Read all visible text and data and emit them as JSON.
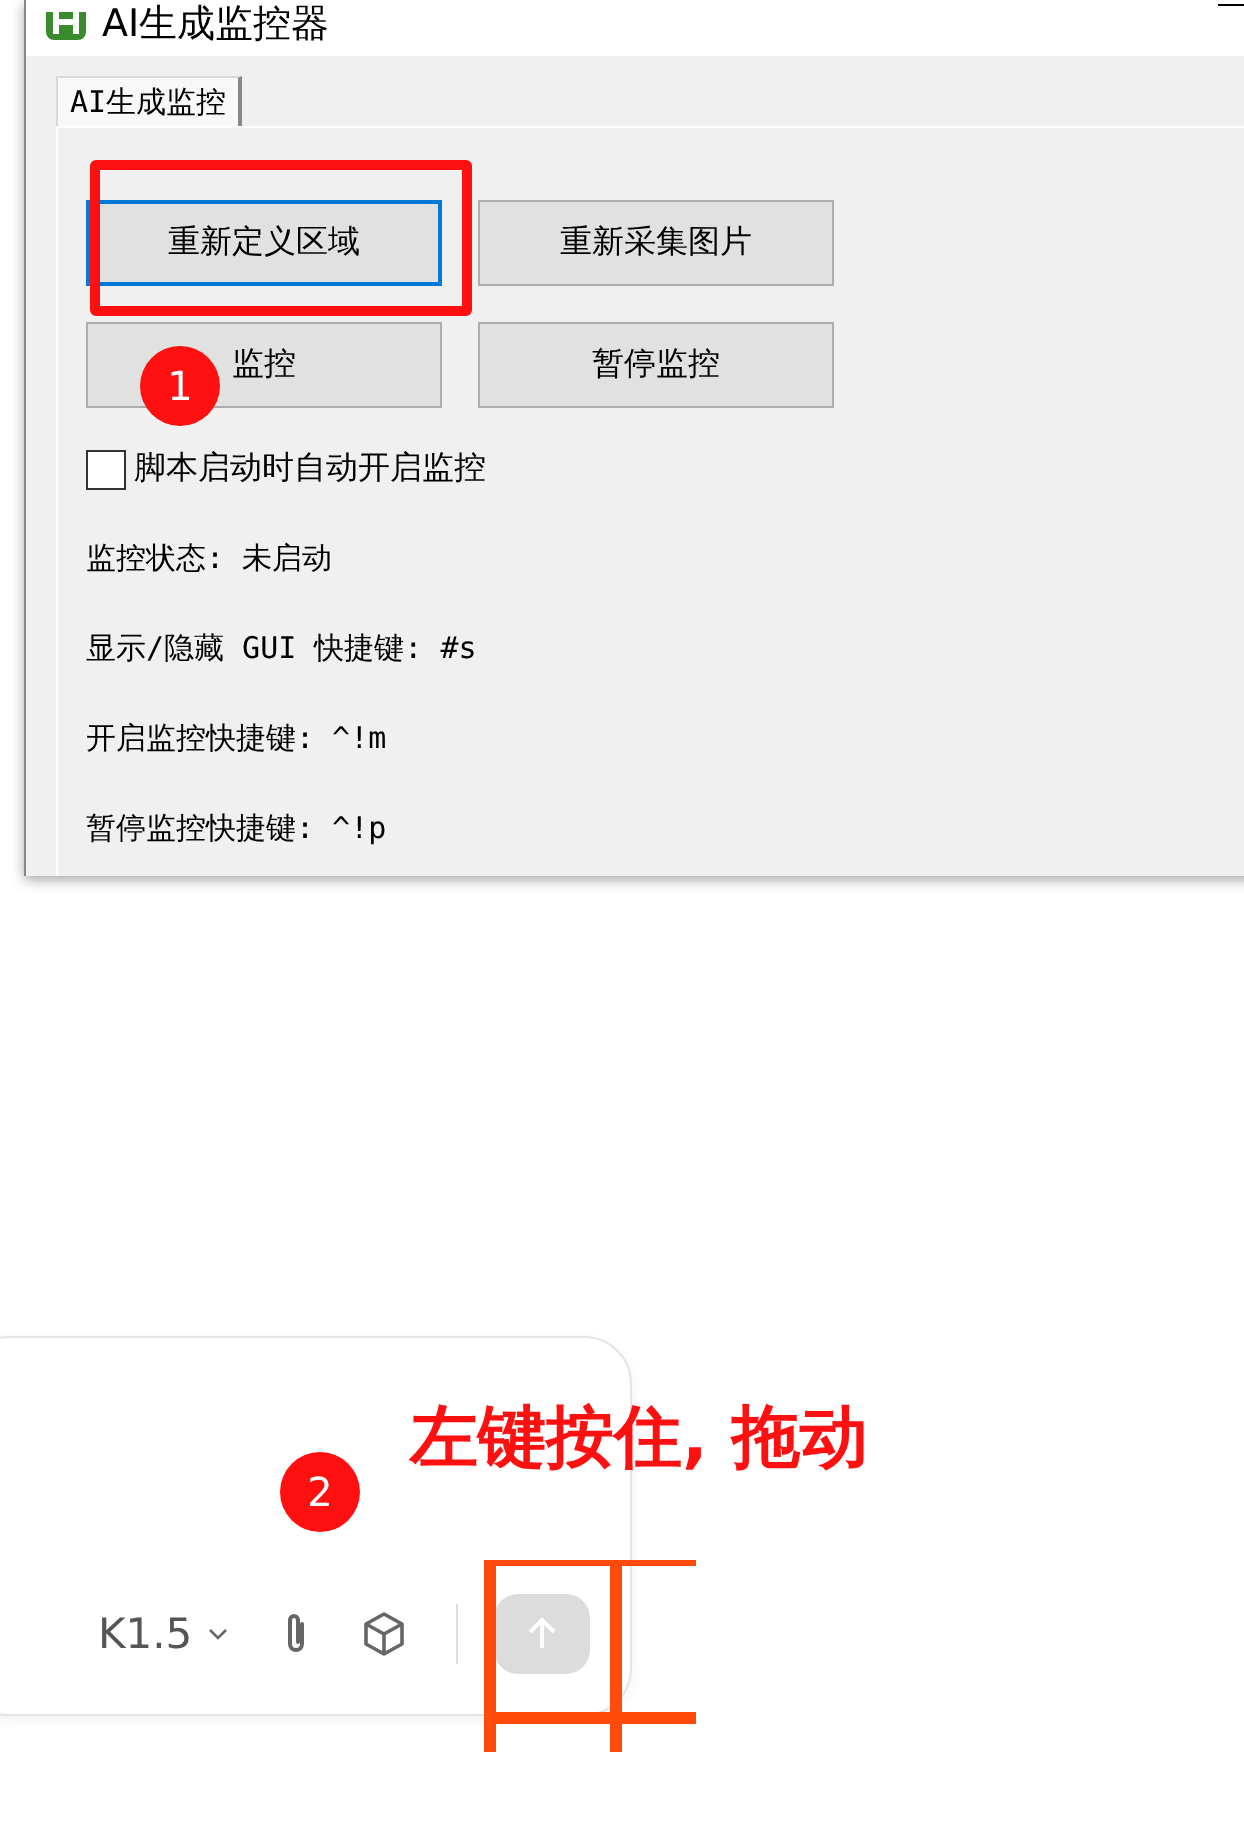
{
  "window": {
    "title": "AI生成监控器"
  },
  "tabs": [
    {
      "label": "AI生成监控",
      "selected": true
    }
  ],
  "buttons": [
    {
      "label": "重新定义区域",
      "focused": true
    },
    {
      "label": "重新采集图片",
      "focused": false
    },
    {
      "label": "监控",
      "focused": false
    },
    {
      "label": "暂停监控",
      "focused": false
    }
  ],
  "checkbox": {
    "label": "脚本启动时自动开启监控",
    "checked": false
  },
  "info_lines": [
    "监控状态: 未启动",
    "显示/隐藏 GUI 快捷键: #s",
    "开启监控快捷键: ^!m",
    "暂停监控快捷键: ^!p"
  ],
  "chat_input": {
    "model": "K1.5"
  },
  "annotations": {
    "markers": [
      {
        "label": "1"
      },
      {
        "label": "2"
      }
    ],
    "instruction": "左键按住, 拖动"
  }
}
